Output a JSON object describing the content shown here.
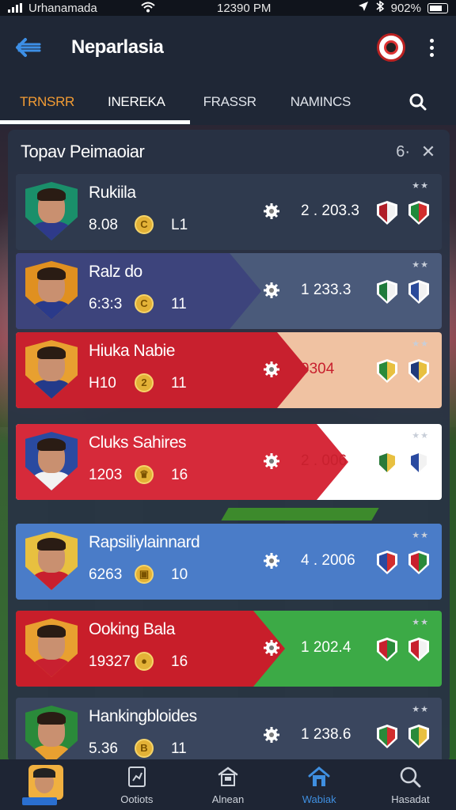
{
  "status_bar": {
    "carrier": "Urhanamada",
    "time": "12390 PM",
    "battery": "902%"
  },
  "header": {
    "title": "Neparlasia"
  },
  "tabs": [
    {
      "label": "TRNSRR",
      "active": true
    },
    {
      "label": "INEREKA"
    },
    {
      "label": "FRASSR"
    },
    {
      "label": "NAMINCS"
    }
  ],
  "panel": {
    "title": "Topav Peimaoiar",
    "count": "6·",
    "close_symbol": "✕"
  },
  "players": [
    {
      "name": "Rukiila",
      "stat1": "8.08",
      "coin": "C",
      "stat2": "L1",
      "value": "2 . 203.3",
      "stars": "★★",
      "colors": {
        "bg1": "#2f3a4e",
        "bg2": "#2f3a4e",
        "crest": "#1a8f6a",
        "shirt": "#2e3a8a",
        "sh1a": "#b01e28",
        "sh1b": "#f2f2f2",
        "sh2a": "#1f8a3a",
        "sh2b": "#d22d2d"
      }
    },
    {
      "name": "Ralz do",
      "stat1": "6:3:3",
      "coin": "C",
      "stat2": "11",
      "value": "1   233.3",
      "stars": "★★",
      "colors": {
        "bg1": "#3d447c",
        "bg2": "#4a5a7a",
        "crest": "#e09020",
        "shirt": "#2a3a8a",
        "sh1a": "#1f7a3a",
        "sh1b": "#f2f2f2",
        "sh2a": "#2a4a9a",
        "sh2b": "#f2f2f2"
      }
    },
    {
      "name": "Hiuka Nabie",
      "stat1": "H10",
      "coin": "2",
      "stat2": "11",
      "value": "9304",
      "stars": "★★",
      "colors": {
        "bg1": "#c8202e",
        "bg2": "#f0c2a2",
        "crest": "#e8a030",
        "shirt": "#243a8a",
        "sh1a": "#2a8a3a",
        "sh1b": "#e8c040",
        "sh2a": "#1f3a7a",
        "sh2b": "#e8c040"
      }
    },
    {
      "name": "Cluks Sahires",
      "stat1": "1203",
      "coin": "♛",
      "stat2": "16",
      "value": "2 . 006",
      "stars": "★★",
      "colors": {
        "bg1": "#d62a3a",
        "bg2": "#ffffff",
        "crest": "#2a4aa0",
        "shirt": "#f2f2f2",
        "sh1a": "#2a7a3a",
        "sh1b": "#e8c040",
        "sh2a": "#2a4aa0",
        "sh2b": "#f2f2f2"
      }
    },
    {
      "name": "Rapsiliylainnard",
      "stat1": "6263",
      "coin": "▣",
      "stat2": "10",
      "value": "4 . 2006",
      "stars": "★★",
      "colors": {
        "bg1": "#4a7cc8",
        "bg2": "#4a7cc8",
        "crest": "#e8c040",
        "shirt": "#c8202e",
        "sh1a": "#2a4aa0",
        "sh1b": "#d22d2d",
        "sh2a": "#c8202e",
        "sh2b": "#2a8a3a"
      }
    },
    {
      "name": "Ooking Bala",
      "stat1": "19327",
      "coin": "●",
      "stat2": "16",
      "value": "1   202.4",
      "stars": "★★",
      "colors": {
        "bg1": "#c81e2a",
        "bg2": "#3caa46",
        "crest": "#e8a030",
        "shirt": "#c82030",
        "sh1a": "#c8202e",
        "sh1b": "#2a8a3a",
        "sh2a": "#c8202e",
        "sh2b": "#f2f2f2"
      }
    },
    {
      "name": "Hankingbloides",
      "stat1": "5.36",
      "coin": "B",
      "stat2": "11",
      "value": "1   238.6",
      "stars": "★★",
      "colors": {
        "bg1": "#3a465e",
        "bg2": "#3a465e",
        "crest": "#2a8a3a",
        "shirt": "#e8a030",
        "sh1a": "#2a8a3a",
        "sh1b": "#d22d2d",
        "sh2a": "#2a8a3a",
        "sh2b": "#e8c040"
      }
    }
  ],
  "bottom_nav": [
    {
      "label": ""
    },
    {
      "label": "Ootiots"
    },
    {
      "label": "Alnean"
    },
    {
      "label": "Wabiak",
      "active": true
    },
    {
      "label": "Hasadat"
    }
  ]
}
